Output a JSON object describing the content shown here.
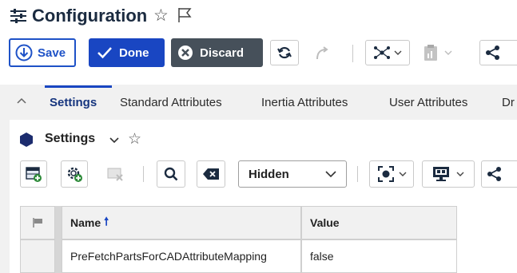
{
  "header": {
    "title": "Configuration"
  },
  "toolbar": {
    "save_label": "Save",
    "done_label": "Done",
    "discard_label": "Discard"
  },
  "tabs": [
    {
      "label": "Settings",
      "active": true
    },
    {
      "label": "Standard Attributes"
    },
    {
      "label": "Inertia Attributes"
    },
    {
      "label": "User Attributes"
    },
    {
      "label": "Dr"
    }
  ],
  "panel": {
    "title": "Settings",
    "filter": {
      "selected": "Hidden"
    }
  },
  "table": {
    "columns": [
      "Name",
      "Value"
    ],
    "sort": "ascending",
    "rows": [
      {
        "name": "PreFetchPartsForCADAttributeMapping",
        "value": "false"
      }
    ]
  },
  "colors": {
    "accent": "#1946c2",
    "discard": "#46505a",
    "panel_bg": "#f1f1f1"
  }
}
